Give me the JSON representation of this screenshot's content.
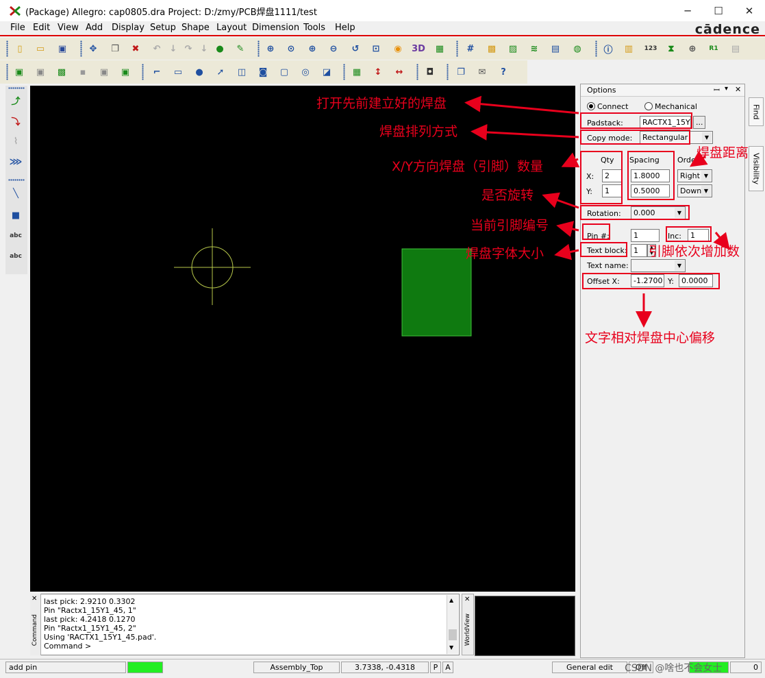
{
  "window": {
    "title": "(Package) Allegro: cap0805.dra  Project: D:/zmy/PCB焊盘1111/test",
    "minimize": "─",
    "maximize": "☐",
    "close": "✕"
  },
  "menu": [
    "File",
    "Edit",
    "View",
    "Add",
    "Display",
    "Setup",
    "Shape",
    "Layout",
    "Dimension",
    "Tools",
    "Help"
  ],
  "brand": "cādence",
  "options_panel": {
    "title": "Options",
    "pin_glyph": "ꟷ",
    "close_glyph": "✕",
    "connect_label": "Connect",
    "mechanical_label": "Mechanical",
    "padstack_label": "Padstack:",
    "padstack_value": "RACTX1_15Y",
    "browse_label": "...",
    "copy_mode_label": "Copy mode:",
    "copy_mode_value": "Rectangular",
    "qty_label": "Qty",
    "spacing_label": "Spacing",
    "order_label": "Order",
    "x_label": "X:",
    "y_label": "Y:",
    "qty_x": "2",
    "qty_y": "1",
    "spacing_x": "1.8000",
    "spacing_y": "0.5000",
    "order_x": "Right",
    "order_y": "Down",
    "rotation_label": "Rotation:",
    "rotation_value": "0.000",
    "pin_label": "Pin #:",
    "pin_value": "1",
    "inc_label": "Inc:",
    "inc_value": "1",
    "text_block_label": "Text block:",
    "text_block_value": "1",
    "text_name_label": "Text name:",
    "text_name_value": "",
    "offset_x_label": "Offset X:",
    "offset_x_value": "-1.2700",
    "offset_y_label": "Y:",
    "offset_y_value": "0.0000"
  },
  "side_tabs": {
    "find": "Find",
    "visibility": "Visibility"
  },
  "annotations": {
    "open_padstack": "打开先前建立好的焊盘",
    "arrangement": "焊盘排列方式",
    "xy_count": "X/Y方向焊盘（引脚）数量",
    "pad_distance": "焊盘距离",
    "rotate": "是否旋转",
    "current_pin": "当前引脚编号",
    "increment": "引脚依次增加数",
    "font_size": "焊盘字体大小",
    "text_offset": "文字相对焊盘中心偏移"
  },
  "console": {
    "side_label": "Command",
    "lines": [
      "last pick:  2.9210 0.3302",
      "Pin \"Ractx1_15Y1_45, 1\"",
      "last pick:  4.2418 0.1270",
      "Pin \"Ractx1_15Y1_45, 2\"",
      "Using 'RACTX1_15Y1_45.pad'.",
      "Command >"
    ]
  },
  "worldview": {
    "side_label": "WorldView"
  },
  "status": {
    "command": "add pin",
    "layer": "Assembly_Top",
    "coords": "3.7338, -0.4318",
    "p_btn": "P",
    "a_btn": "A",
    "mode": "General edit",
    "watermark": "CSDN @啥也不会女士",
    "count": "0",
    "run_color": "#22ee22",
    "drc_color": "#22ee22"
  },
  "colors": {
    "annotation": "#e8001c",
    "pad_fill": "#0f7a10",
    "origin": "#b8c94a"
  }
}
